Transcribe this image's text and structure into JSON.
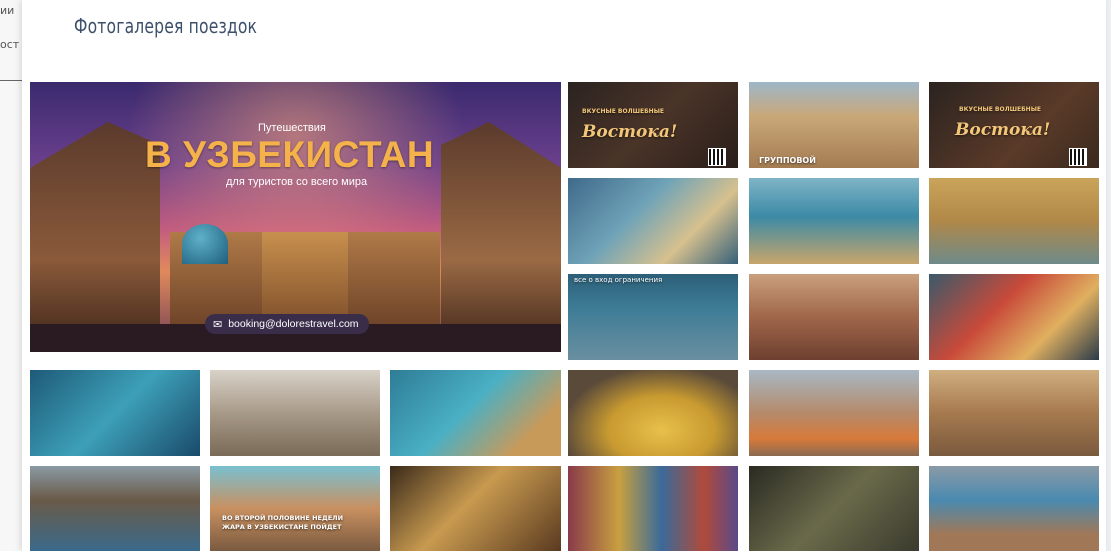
{
  "background": {
    "left_text_1": "ии",
    "left_text_2": "ост"
  },
  "gallery": {
    "title": "Фотогалерея поездок",
    "hero": {
      "subtitle_top": "Путешествия",
      "title": "В УЗБЕКИСТАН",
      "subtitle_bottom": "для туристов со всего мира",
      "email": "booking@dolorestravel.com"
    },
    "tiles": {
      "promo1_small": "ВКУСНЫЕ ВОЛШЕБНЫЕ",
      "promo1_title": "Востока!",
      "promo2_small": "ВКУСНЫЕ ВОЛШЕБНЫЕ",
      "promo2_title": "Востока!",
      "group_label": "ГРУППОВОЙ",
      "caption_row3": "все о вход ограничения",
      "caption_row5": "ВО ВТОРОЙ ПОЛОВИНЕ НЕДЕЛИ ЖАРА В УЗБЕКИСТАНЕ ПОЙДЕТ"
    }
  },
  "colors": {
    "title": "#3d506a",
    "hero_accent": "#f5b24a"
  }
}
